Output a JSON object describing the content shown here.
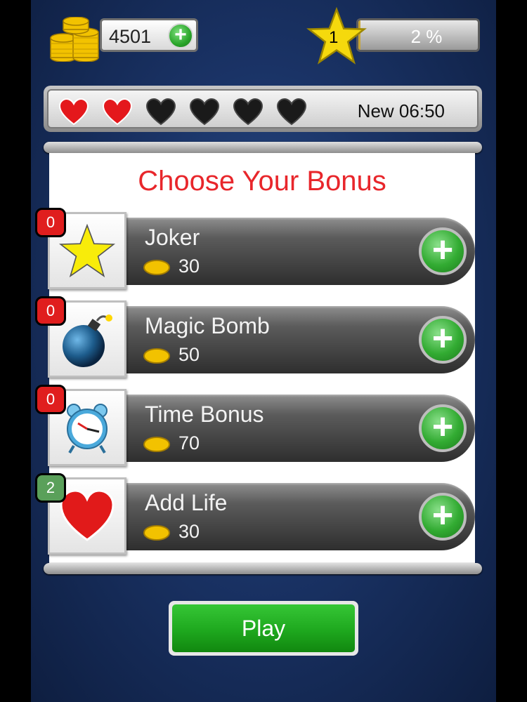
{
  "header": {
    "coins": "4501",
    "level": "1",
    "progress_text": "2 %",
    "progress_fraction": 0.02
  },
  "lives": {
    "full": 2,
    "total": 6,
    "timer_text": "New 06:50"
  },
  "panel": {
    "title": "Choose Your Bonus",
    "items": [
      {
        "name": "Joker",
        "cost": "30",
        "count": "0",
        "icon": "star-icon",
        "badge_color": "red"
      },
      {
        "name": "Magic Bomb",
        "cost": "50",
        "count": "0",
        "icon": "bomb-icon",
        "badge_color": "red"
      },
      {
        "name": "Time Bonus",
        "cost": "70",
        "count": "0",
        "icon": "alarm-clock-icon",
        "badge_color": "red"
      },
      {
        "name": "Add Life",
        "cost": "30",
        "count": "2",
        "icon": "heart-icon",
        "badge_color": "green"
      }
    ]
  },
  "play_button": {
    "label": "Play"
  },
  "colors": {
    "title_red": "#e8262b",
    "plus_green": "#2aa52a",
    "play_green": "#1ea81e",
    "background_blue": "#1a3366"
  }
}
